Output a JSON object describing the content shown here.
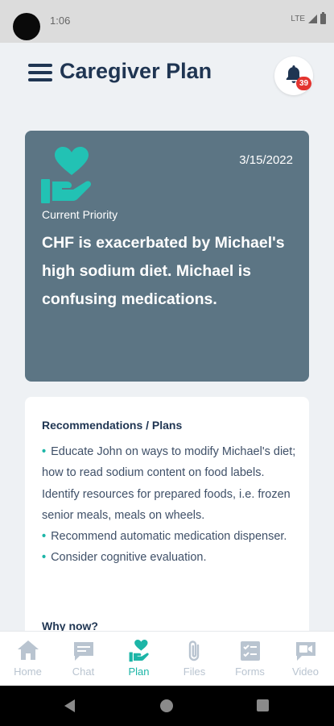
{
  "status_bar": {
    "time": "1:06",
    "network": "LTE"
  },
  "header": {
    "title": "Caregiver Plan",
    "notification_count": "39"
  },
  "priority_card": {
    "date": "3/15/2022",
    "label": "Current Priority",
    "text": "CHF is exacerbated by Michael's high sodium diet. Michael is confusing medications."
  },
  "recommendations": {
    "title": "Recommendations / Plans",
    "items": [
      "Educate John on ways to modify Michael's diet; how to read sodium content on food labels.  Identify resources for prepared foods, i.e. frozen senior meals, meals on wheels.",
      "Recommend automatic medication dispenser.",
      "Consider cognitive evaluation."
    ],
    "why_now_title": "Why now?"
  },
  "nav": {
    "items": [
      {
        "label": "Home",
        "icon": "home-icon"
      },
      {
        "label": "Chat",
        "icon": "chat-icon"
      },
      {
        "label": "Plan",
        "icon": "plan-icon"
      },
      {
        "label": "Files",
        "icon": "paperclip-icon"
      },
      {
        "label": "Forms",
        "icon": "forms-icon"
      },
      {
        "label": "Video",
        "icon": "video-icon"
      }
    ],
    "active": "Plan"
  },
  "colors": {
    "primary_dark": "#1f3552",
    "accent_teal": "#1cb5a7",
    "card_slate": "#5c7584",
    "badge_red": "#e3342f",
    "nav_inactive": "#b9c4d0"
  }
}
